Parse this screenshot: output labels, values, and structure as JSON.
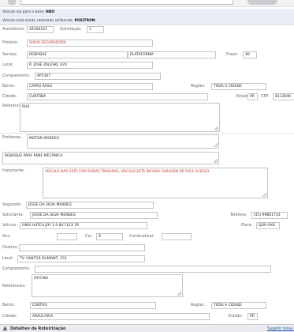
{
  "info": {
    "base_label": "Veículo vai para a base:",
    "base_value": "NÃO",
    "tracking_label": "Veículo está sendo rastreado utilizando:",
    "tracking_value": "POSITRON"
  },
  "labels": {
    "assistencia": "Assistência:",
    "solicitacao": "Solicitação:",
    "produto": "Produto:",
    "servico": "Serviço:",
    "prazo": "Prazo:",
    "local": "Local:",
    "complemento": "Complemento:",
    "bairro": "Bairro:",
    "regiao": "Região:",
    "cidade": "Cidade:",
    "estado": "Estado:",
    "cep": "CEP:",
    "referencias": "Referências:",
    "problema": "Problema:",
    "importante": "Importante:",
    "segurado": "Segurado:",
    "solicitante": "Solicitante:",
    "telefone": "Telefone:",
    "veiculo": "Veículo:",
    "placa": "Placa:",
    "ano": "Ano:",
    "cor": "Cor:",
    "combustivel": "Combustível:",
    "destino": "Destino:"
  },
  "origin": {
    "assistencia": "49104121",
    "solicitacao": "1",
    "produto": "SUHAI SEGURADORA",
    "servico": "REBOQUE",
    "plataforma": "PLATAFORMA",
    "prazo": "40",
    "local": "R. JOSE ZALESKI, 674",
    "complemento": "AP1307",
    "bairro": "CAPAO RASO",
    "regiao": "TODA A CIDADE",
    "cidade": "CURITIBA",
    "estado": "PR",
    "cep": "8113006",
    "referencias": "RUA"
  },
  "problem": {
    "problema": "MOTOR MORREU",
    "descricao": "REBOQUE PARA PANE MECÂNICA",
    "importante": "VEICULO NÃO ESTÁ COM RODAS TRAVADAS, VEICULO ESTÁ EM UMA GARAGEM DE FACIL ACESSO."
  },
  "vehicle": {
    "segurado": "JESSE DA SILVA MENDES",
    "solicitante": "JESSE DA SILVA MENDES",
    "telefone": "(41) 99861733",
    "veiculo": "ONIX HATCH JOY 1.0 8V FLEX 5P",
    "placa": "QOH-XXX",
    "ano": "",
    "cor": "9",
    "combustivel": ""
  },
  "destination": {
    "destino": "",
    "local": "TV. SANTOS DUMONT, 151",
    "complemento": "",
    "referencias": "OFICINA",
    "bairro": "CENTRO",
    "regiao": "TODA A CIDADE",
    "cidade": "ARAUCARIA",
    "estado": "PR"
  },
  "footer": {
    "title": "Detalhes da Roteirização",
    "link": "Sugerir nova r",
    "arrow_icon": "chevron-up-icon"
  }
}
